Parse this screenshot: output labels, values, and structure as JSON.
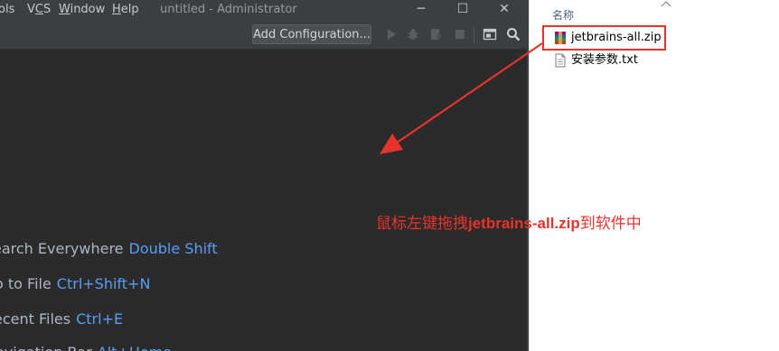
{
  "ide": {
    "menu": [
      "ols",
      "VCS",
      "Window",
      "Help"
    ],
    "window_title": "untitled - Administrator",
    "window_controls": {
      "minimize": "─",
      "maximize": "☐",
      "close": "✕"
    },
    "toolbar": {
      "add_configuration": "Add Configuration...",
      "icons": [
        "run-icon",
        "debug-icon",
        "coverage-icon",
        "stop-icon",
        "project-structure-icon",
        "search-icon"
      ]
    },
    "hints": [
      {
        "action": "earch Everywhere",
        "key": "Double Shift"
      },
      {
        "action": "o to File",
        "key": "Ctrl+Shift+N"
      },
      {
        "action": "ecent Files",
        "key": "Ctrl+E"
      },
      {
        "action": "avigation Bar",
        "key": "Alt+Home"
      }
    ]
  },
  "explorer": {
    "column_header": "名称",
    "files": [
      {
        "name": "jetbrains-all.zip",
        "icon": "winrar-archive-icon",
        "highlighted": true
      },
      {
        "name": "安装参数.txt",
        "icon": "text-file-icon",
        "highlighted": false
      }
    ]
  },
  "annotation": {
    "prefix": "鼠标左键拖拽",
    "file": "jetbrains-all.zip",
    "suffix": "到软件中",
    "color": "#e8332b"
  },
  "colors": {
    "ide_background": "#2b2b2b",
    "ide_chrome": "#3c3f41",
    "shortcut_blue": "#589df6",
    "annotation_red": "#e8332b"
  }
}
